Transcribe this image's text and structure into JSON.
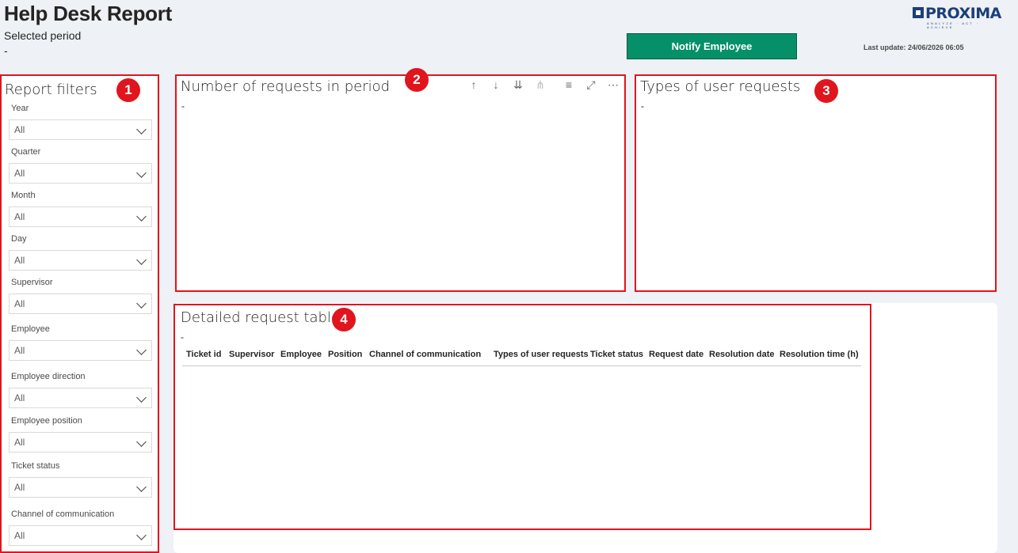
{
  "header": {
    "title": "Help Desk Report",
    "period_label": "Selected period",
    "period_value": "-",
    "notify_button": "Notify Employee",
    "last_update": "Last update: 24/06/2026 06:05",
    "logo_text": "PROXIMA",
    "logo_tagline": "ANALYZE · ACT · ACHIEVE"
  },
  "callouts": [
    "1",
    "2",
    "3",
    "4"
  ],
  "filters": {
    "title": "Report filters",
    "items": [
      {
        "label": "Year",
        "value": "All"
      },
      {
        "label": "Quarter",
        "value": "All"
      },
      {
        "label": "Month",
        "value": "All"
      },
      {
        "label": "Day",
        "value": "All"
      },
      {
        "label": "Supervisor",
        "value": "All"
      },
      {
        "label": "Employee",
        "value": "All"
      },
      {
        "label": "Employee direction",
        "value": "All"
      },
      {
        "label": "Employee position",
        "value": "All"
      },
      {
        "label": "Ticket status",
        "value": "All"
      },
      {
        "label": "Channel of communication",
        "value": "All"
      }
    ]
  },
  "requests_panel": {
    "title": "Number of requests in period",
    "subtitle": "-",
    "toolbar": {
      "sort_asc": "↑",
      "sort_desc": "↓",
      "drill_all": "⇊",
      "expand": "⋔",
      "filter": "≡",
      "focus": "⤢",
      "more": "⋯"
    }
  },
  "types_panel": {
    "title": "Types of user requests",
    "subtitle": "-"
  },
  "detail_panel": {
    "title": "Detailed request table",
    "subtitle": "-",
    "columns": [
      "Ticket id",
      "Supervisor",
      "Employee",
      "Position",
      "Channel of communication",
      "Types of user requests",
      "Ticket status",
      "Request date",
      "Resolution date",
      "Resolution time (h)"
    ]
  },
  "colors": {
    "accent_button": "#05906a",
    "annotation_red": "#e0151d",
    "brand_blue": "#1c3f7a",
    "background": "#eef1f5"
  }
}
